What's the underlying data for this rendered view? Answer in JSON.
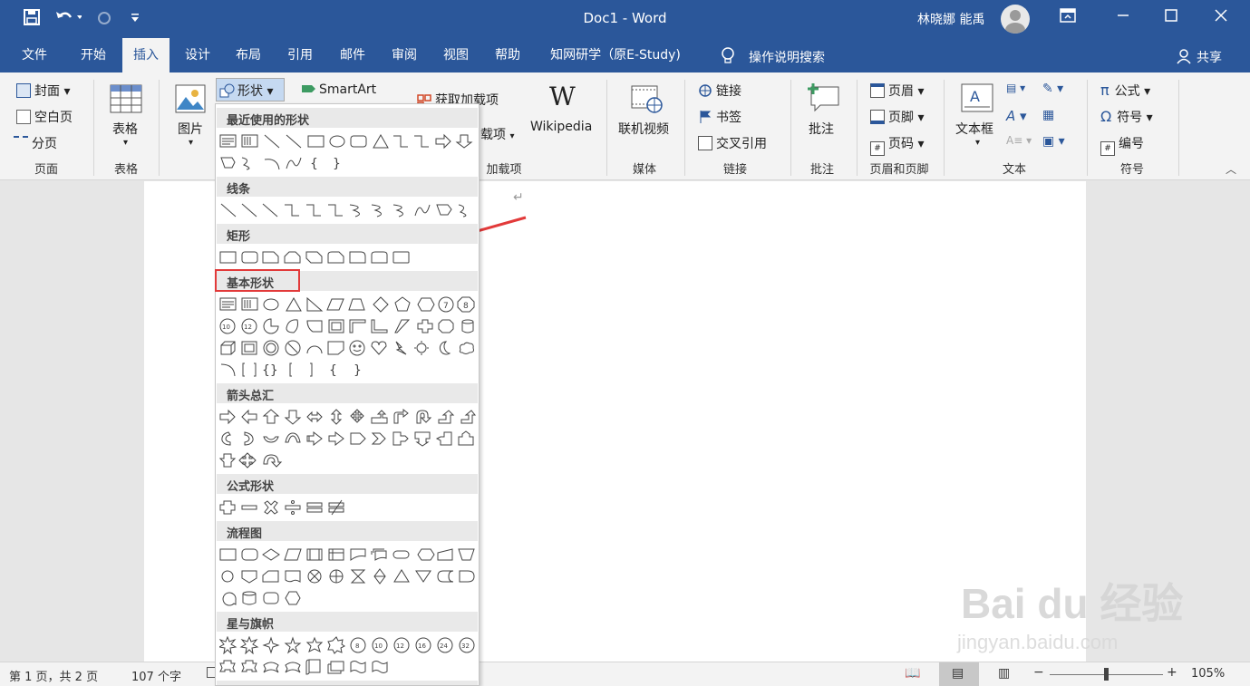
{
  "title": "Doc1  -  Word",
  "user": "林晓娜 能禹",
  "tabs": [
    "文件",
    "开始",
    "插入",
    "设计",
    "布局",
    "引用",
    "邮件",
    "审阅",
    "视图",
    "帮助",
    "知网研学（原E-Study)"
  ],
  "tell_me": "操作说明搜索",
  "share": "共享",
  "ribbon": {
    "pages": {
      "cover": "封面",
      "blank": "空白页",
      "break": "分页",
      "label": "页面"
    },
    "tables": {
      "table": "表格",
      "label": "表格"
    },
    "illustrations": {
      "picture": "图片",
      "shapes": "形状",
      "smartart": "SmartArt"
    },
    "addins": {
      "get": "获取加载项",
      "my": "载项",
      "wiki": "Wikipedia",
      "label": "加载项"
    },
    "media": {
      "video": "联机视频",
      "label": "媒体"
    },
    "links": {
      "link": "链接",
      "bookmark": "书签",
      "xref": "交叉引用",
      "label": "链接"
    },
    "comments": {
      "comment": "批注",
      "label": "批注"
    },
    "header_footer": {
      "header": "页眉",
      "footer": "页脚",
      "page_no": "页码",
      "label": "页眉和页脚"
    },
    "text": {
      "textbox": "文本框",
      "label": "文本"
    },
    "symbols": {
      "equation": "公式",
      "symbol": "符号",
      "number": "编号",
      "label": "符号"
    }
  },
  "shapes_panel": {
    "sections": [
      "最近使用的形状",
      "线条",
      "矩形",
      "基本形状",
      "箭头总汇",
      "公式形状",
      "流程图",
      "星与旗帜"
    ],
    "highlighted": "基本形状"
  },
  "status": {
    "page": "第 1 页，共 2 页",
    "words": "107 个字",
    "zoom": "105%"
  },
  "watermark": {
    "main": "Bai du 经验",
    "sub": "jingyan.baidu.com"
  }
}
